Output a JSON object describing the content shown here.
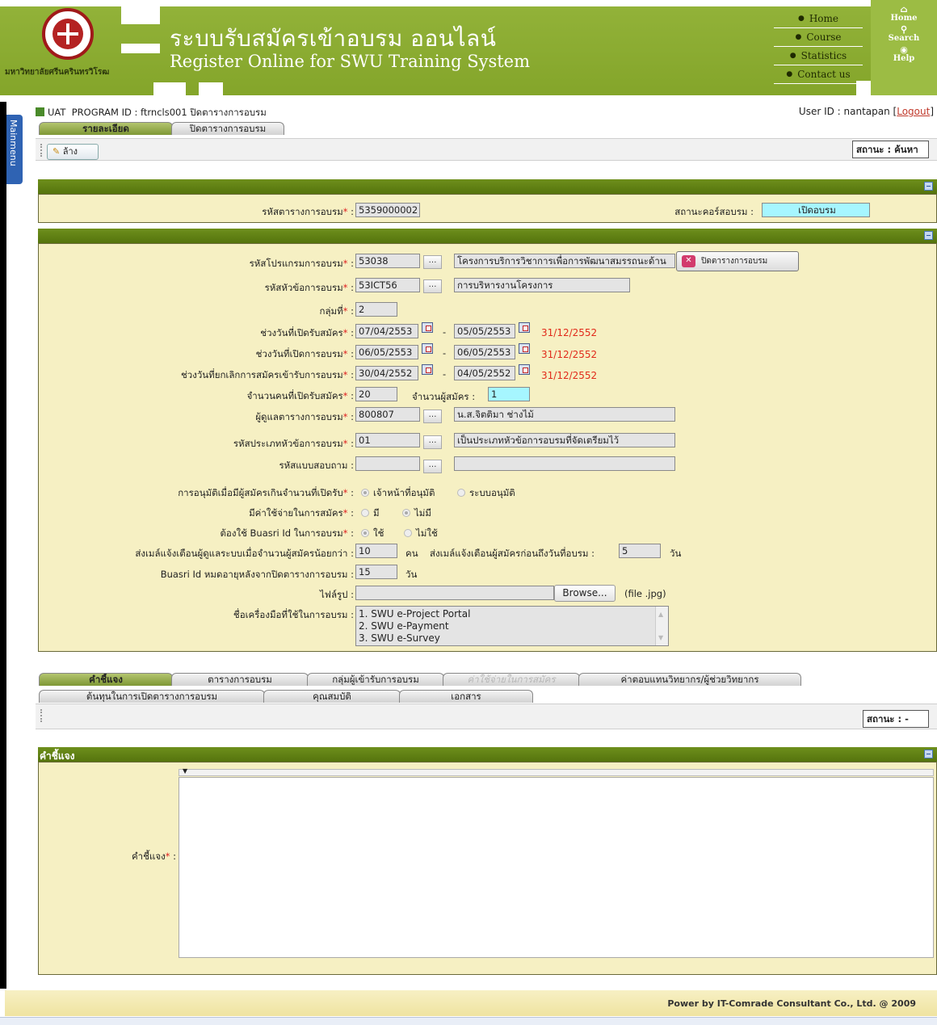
{
  "header": {
    "university": "มหาวิทยาลัยศรีนครินทรวิโรฒ",
    "title_th": "ระบบรับสมัครเข้าอบรม ออนไลน์",
    "title_en": "Register Online for SWU Training System",
    "nav": [
      "Home",
      "Course",
      "Statistics",
      "Contact us"
    ],
    "side": [
      "Home",
      "Search",
      "Help"
    ]
  },
  "mainmenu": "Mainmenu",
  "program": {
    "env": "UAT",
    "label": "PROGRAM ID : ftrncls001 ปิดตารางการอบรม",
    "user_prefix": "User ID : nantapan [",
    "logout": "Logout",
    "user_suffix": "]"
  },
  "top_tabs": [
    "รายละเอียด",
    "ปิดตารางการอบรม"
  ],
  "toolbar": {
    "clear": "ล้าง",
    "status": "สถานะ : ค้นหา"
  },
  "section1": {
    "code_label": "รหัสตารางการอบรม",
    "code_value": "5359000002",
    "course_status_label": "สถานะคอร์สอบรม :",
    "course_status_value": "เปิดอบรม"
  },
  "form": {
    "program_label": "รหัสโปรแกรมการอบรม",
    "program_code": "53038",
    "program_name": "โครงการบริการวิชาการเพื่อการพัฒนาสมรรถนะด้าน",
    "close_button": "ปิดตารางการอบรม",
    "topic_label": "รหัสหัวข้อการอบรม",
    "topic_code": "53ICT56",
    "topic_name": "การบริหารงานโครงการ",
    "group_label": "กลุ่มที่",
    "group_value": "2",
    "reg_period_label": "ช่วงวันที่เปิดรับสมัคร",
    "reg_from": "07/04/2553",
    "reg_to": "05/05/2553",
    "reg_note": "31/12/2552",
    "train_period_label": "ช่วงวันที่เปิดการอบรม",
    "train_from": "06/05/2553",
    "train_to": "06/05/2553",
    "train_note": "31/12/2552",
    "cancel_period_label": "ช่วงวันที่ยกเลิกการสมัครเข้ารับการอบรม",
    "cancel_from": "30/04/2552",
    "cancel_to": "04/05/2552",
    "cancel_note": "31/12/2552",
    "seats_label": "จำนวนคนที่เปิดรับสมัคร",
    "seats_value": "20",
    "applicants_label": "จำนวนผู้สมัคร :",
    "applicants_value": "1",
    "owner_label": "ผู้ดูแลตารางการอบรม",
    "owner_code": "800807",
    "owner_name": "น.ส.จิตติมา ช่างไม้",
    "type_label": "รหัสประเภทหัวข้อการอบรม",
    "type_code": "01",
    "type_name": "เป็นประเภทหัวข้อการอบรมที่จัดเตรียมไว้",
    "survey_label": "รหัสแบบสอบถาม :",
    "approval_label": "การอนุมัติเมื่อมีผู้สมัครเกินจำนวนที่เปิดรับ",
    "approval_opt1": "เจ้าหน้าที่อนุมัติ",
    "approval_opt2": "ระบบอนุมัติ",
    "fee_label": "มีค่าใช้จ่ายในการสมัคร",
    "fee_opt1": "มี",
    "fee_opt2": "ไม่มี",
    "buasri_label": "ต้องใช้ Buasri Id ในการอบรม",
    "buasri_opt1": "ใช้",
    "buasri_opt2": "ไม่ใช้",
    "mail_min_label": "ส่งเมล์แจ้งเตือนผู้ดูแลระบบเมื่อจำนวนผู้สมัครน้อยกว่า :",
    "mail_min_value": "10",
    "mail_min_unit": "คน",
    "mail_days_label": "ส่งเมล์แจ้งเตือนผู้สมัครก่อนถึงวันที่อบรม :",
    "mail_days_value": "5",
    "mail_days_unit": "วัน",
    "expire_label": "Buasri Id หมดอายุหลังจากปิดตารางการอบรม :",
    "expire_value": "15",
    "expire_unit": "วัน",
    "image_label": "ไฟล์รูป :",
    "browse": "Browse...",
    "image_hint": "(file .jpg)",
    "tools_label": "ชื่อเครื่องมือที่ใช้ในการอบรม :",
    "tools": [
      "1. SWU e-Project Portal",
      "2. SWU e-Payment",
      "3. SWU e-Survey"
    ]
  },
  "bottom_tabs_row1": [
    "คำชี้แจง",
    "ตารางการอบรม",
    "กลุ่มผู้เข้ารับการอบรม",
    "ค่าใช้จ่ายในการสมัคร",
    "ค่าตอบแทนวิทยากร/ผู้ช่วยวิทยากร"
  ],
  "bottom_tabs_row2": [
    "ต้นทุนในการเปิดตารางการอบรม",
    "คุณสมบัติ",
    "เอกสาร"
  ],
  "toolbar2": {
    "status": "สถานะ : -"
  },
  "desc_section": {
    "title": "คำชี้แจง",
    "label": "คำชี้แจง"
  },
  "footer": "Power by IT-Comrade Consultant Co., Ltd. @ 2009",
  "colors": {
    "header_green": "#8bab31",
    "panel_cream": "#f6f0c3",
    "bar_green": "#607f12",
    "required": "#e02020"
  }
}
